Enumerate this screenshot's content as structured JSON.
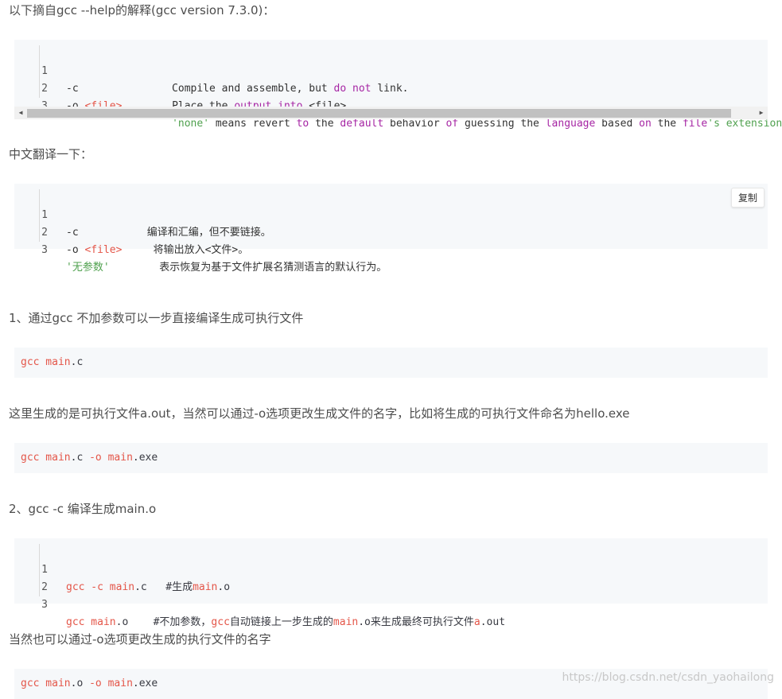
{
  "intro": "以下摘自gcc --help的解释(gcc version 7.3.0)：",
  "block1": {
    "nums": [
      "1",
      "2",
      "3"
    ],
    "line1": {
      "a": "-c               Compile and assemble, but ",
      "b": "do",
      "c": " ",
      "d": "not",
      "e": " link."
    },
    "line2": {
      "a": "-o ",
      "b": "<file>",
      "c": "        Place the ",
      "d": "output",
      "e": " ",
      "f": "into",
      "g": " <file>."
    },
    "line3": {
      "pad": "                 ",
      "a": "'none'",
      "b": " means revert ",
      "c": "to",
      "d": " the ",
      "e": "default",
      "f": " behavior ",
      "g": "of",
      "h": " guessing the ",
      "i": "language",
      "j": " based ",
      "k": "on",
      "l": " the ",
      "m": "file",
      "n": "'s extension."
    }
  },
  "translate_heading": "中文翻译一下：",
  "block2": {
    "copy_label": "复制",
    "nums": [
      "1",
      "2",
      "3"
    ],
    "line1": "-c           编译和汇编，但不要链接。",
    "line2": {
      "a": "-o ",
      "b": "<file>",
      "c": "     将输出放入<文件>。"
    },
    "line3": {
      "a": "'无参数'",
      "b": "        表示恢复为基于文件扩展名猜测语言的默认行为。"
    }
  },
  "section1_heading": "1、通过gcc 不加参数可以一步直接编译生成可执行文件",
  "cmd1": {
    "a": "gcc",
    "b": " main",
    "c": ".c"
  },
  "para2": "这里生成的是可执行文件a.out，当然可以通过-o选项更改生成文件的名字，比如将生成的可执行文件命名为hello.exe",
  "cmd2": {
    "a": "gcc",
    "b": " main",
    "c": ".c",
    "d": " -o",
    "e": " main",
    "f": ".exe"
  },
  "section2_heading": "2、gcc -c 编译生成main.o",
  "block3": {
    "nums": [
      "1",
      "2",
      "3"
    ],
    "line1": {
      "a": "gcc",
      "b": " -c",
      "c": " main",
      "d": ".c",
      "e": "   #生成",
      "f": "main",
      "g": ".o"
    },
    "line3": {
      "a": "gcc",
      "b": " main",
      "c": ".o",
      "d": "    #不加参数，",
      "e": "gcc",
      "f": "自动链接上一步生成的",
      "g": "main",
      "h": ".o",
      "i": "来生成最终可执行文件",
      "j": "a",
      "k": ".out"
    }
  },
  "para3": "当然也可以通过-o选项更改生成的执行文件的名字",
  "cmd3": {
    "a": "gcc",
    "b": " main",
    "c": ".o",
    "d": " -o",
    "e": " main",
    "f": ".exe"
  },
  "watermark": "https://blog.csdn.net/csdn_yaohailong",
  "colors": {
    "keyword": "#a626a4",
    "string": "#50a14f",
    "tag": "#e45649",
    "code_bg": "#f6f8fa"
  }
}
